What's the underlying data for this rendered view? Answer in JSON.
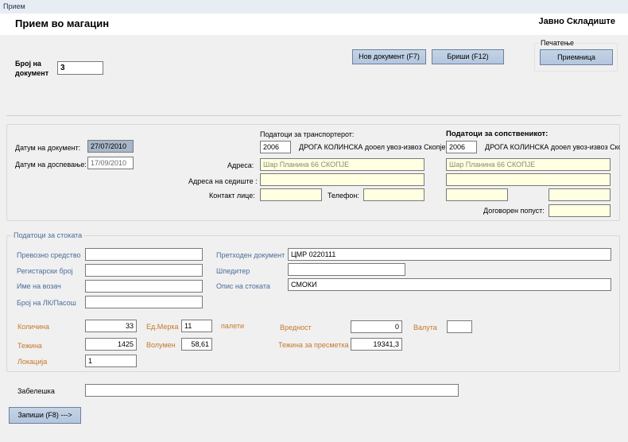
{
  "window": {
    "title": "Прием"
  },
  "header": {
    "title": "Прием во магацин",
    "company": "Јавно Складиште"
  },
  "document": {
    "number_label_line1": "Број на",
    "number_label_line2": "документ",
    "number_value": "3"
  },
  "toolbar": {
    "new_doc": "Нов документ (F7)",
    "delete": "Бриши (F12)"
  },
  "print": {
    "group_label": "Печатење",
    "button": "Приемница"
  },
  "dates": {
    "doc_date_label": "Датум на документ:",
    "doc_date_value": "27/07/2010",
    "due_date_label": "Датум на доспевање:",
    "due_date_value": "17/09/2010"
  },
  "transporter": {
    "heading": "Податоци за транспортерот:",
    "code": "2006",
    "name": "ДРОГА КОЛИНСКА дооел увоз-извоз Скопје",
    "address_label": "Адреса:",
    "address_value": "Шар Планина 66 СКОПЈЕ",
    "seat_label": "Адреса на седиште :",
    "contact_label": "Контакт лице:",
    "phone_label": "Телефон:"
  },
  "owner": {
    "heading": "Податоци за сопственикот:",
    "code": "2006",
    "name": "ДРОГА КОЛИНСКА дооел увоз-извоз Скоп",
    "address_value": "Шар Планина 66 СКОПЈЕ",
    "discount_label": "Договорен попуст:"
  },
  "goods": {
    "group_label": "Податоци за стоката",
    "vehicle_label": "Превозно средство",
    "reg_label": "Регистарски број",
    "driver_label": "Име на возач",
    "id_label": "Број на ЛК/Пасош",
    "prev_doc_label": "Претходен документ",
    "prev_doc_value": "ЦМР 0220111",
    "forwarder_label": "Шпедитер",
    "desc_label": "Опис на стоката",
    "desc_value": "СМОКИ",
    "qty_label": "Количина",
    "qty_value": "33",
    "unit_label": "Ед.Мерка",
    "unit_value": "11",
    "unit_name": "палети",
    "value_label": "Вредност",
    "value_value": "0",
    "currency_label": "Валута",
    "weight_label": "Тежина",
    "weight_value": "1425",
    "volume_label": "Волумен",
    "volume_value": "58,61",
    "calc_weight_label": "Тежина за пресметка",
    "calc_weight_value": "19341,3",
    "location_label": "Локација",
    "location_value": "1"
  },
  "footer": {
    "note_label": "Забелешка",
    "save": "Запиши (F8) --->"
  }
}
